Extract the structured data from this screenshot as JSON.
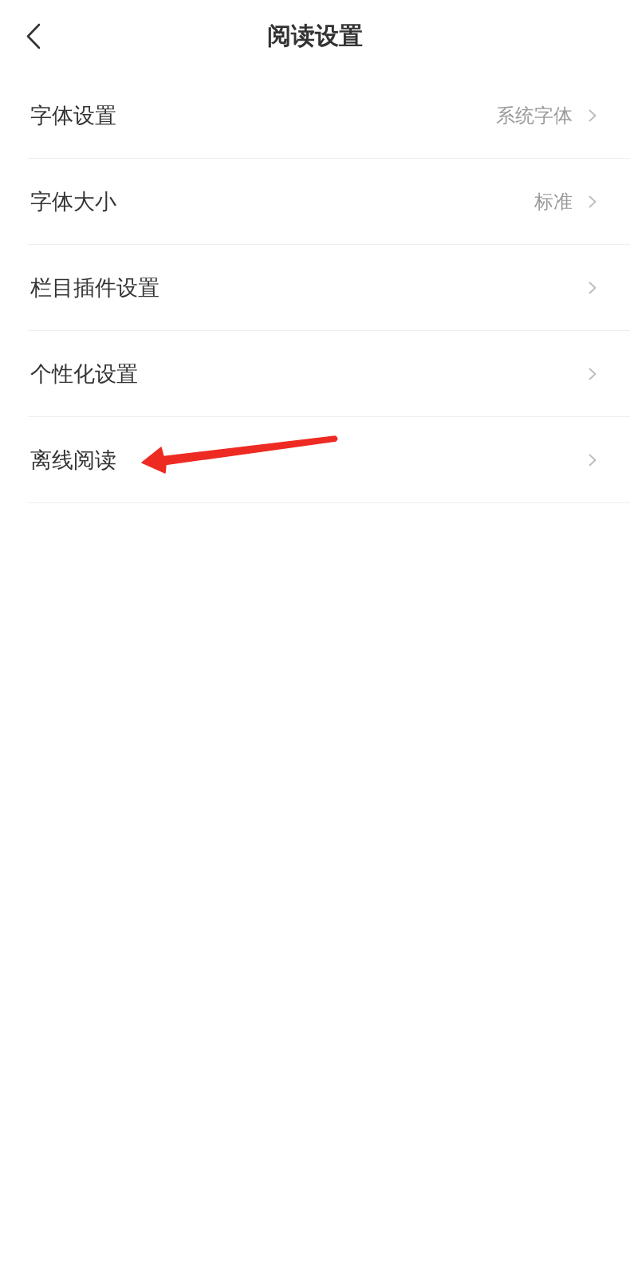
{
  "header": {
    "title": "阅读设置"
  },
  "settings": [
    {
      "label": "字体设置",
      "value": "系统字体",
      "annotated": false
    },
    {
      "label": "字体大小",
      "value": "标准",
      "annotated": false
    },
    {
      "label": "栏目插件设置",
      "annotated": false
    },
    {
      "label": "个性化设置",
      "annotated": false
    },
    {
      "label": "离线阅读",
      "annotated": true
    }
  ]
}
